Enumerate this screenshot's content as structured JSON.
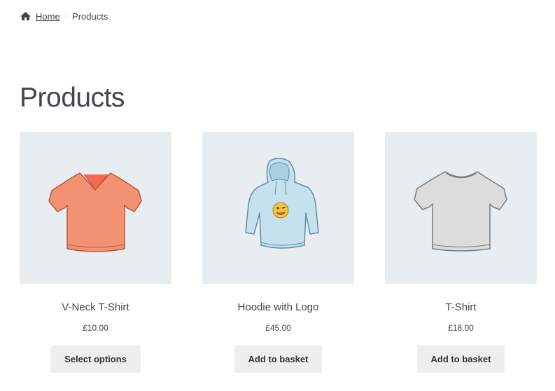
{
  "breadcrumb": {
    "home_icon": "home-icon",
    "home_label": "Home",
    "current_label": "Products"
  },
  "page": {
    "title": "Products"
  },
  "products": [
    {
      "name": "V-Neck T-Shirt",
      "price": "£10.00",
      "button_label": "Select options",
      "image_icon": "vneck-tshirt-image",
      "color": "#f28a6f"
    },
    {
      "name": "Hoodie with Logo",
      "price": "£45.00",
      "button_label": "Add to basket",
      "image_icon": "hoodie-image",
      "color": "#bfdcea"
    },
    {
      "name": "T-Shirt",
      "price": "£18.00",
      "button_label": "Add to basket",
      "image_icon": "tshirt-image",
      "color": "#d9d9d9"
    }
  ],
  "colors": {
    "card_background": "#e8edf2",
    "button_background": "#eeeeee",
    "text": "#43454b"
  }
}
